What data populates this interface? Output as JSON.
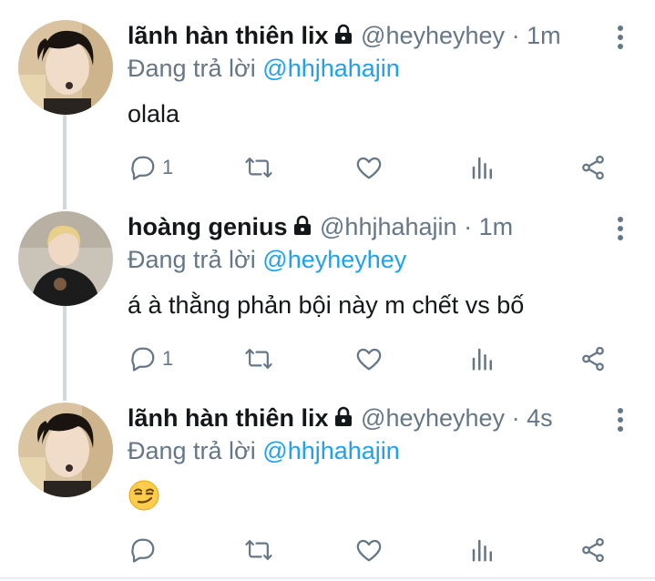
{
  "colors": {
    "link": "#1da1f2",
    "muted": "#657786",
    "text": "#14171a"
  },
  "tweets": [
    {
      "name": "lãnh hàn thiên lix",
      "handle": "@heyheyhey",
      "dot": "·",
      "time": "1m",
      "reply_prefix": "Đang trả lời",
      "reply_to": "@hhjhahajin",
      "text": "olala",
      "reply_count": "1",
      "locked": true,
      "avatar_icon": "avatar-photo"
    },
    {
      "name": "hoàng genius",
      "handle": "@hhjhahajin",
      "dot": "·",
      "time": "1m",
      "reply_prefix": "Đang trả lời",
      "reply_to": "@heyheyhey",
      "text": "á à thằng phản bội này m chết vs bố",
      "reply_count": "1",
      "locked": true,
      "avatar_icon": "avatar-photo"
    },
    {
      "name": "lãnh hàn thiên lix",
      "handle": "@heyheyhey",
      "dot": "·",
      "time": "4s",
      "reply_prefix": "Đang trả lời",
      "reply_to": "@hhjhahajin",
      "text": "",
      "emoji": "smirking-face-emoji",
      "reply_count": "",
      "locked": true,
      "avatar_icon": "avatar-photo"
    }
  ]
}
